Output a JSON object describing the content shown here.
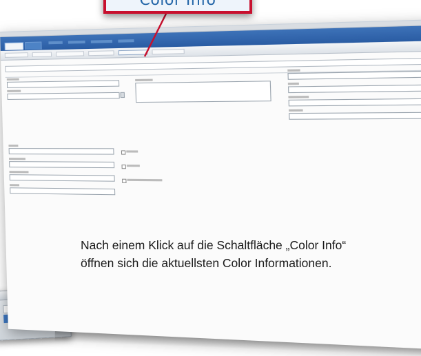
{
  "callout": {
    "label": "Color Info"
  },
  "caption": {
    "line1": "Nach einem Klick auf die Schaltfläche „Color Info“",
    "line2": "öffnen sich die aktuellsten Color Informationen."
  },
  "colors": {
    "callout_border": "#c8102e",
    "callout_text": "#2466a8",
    "menubar": "#2a5ca3"
  },
  "icons": {
    "window_controls": "minimize-close-icons"
  }
}
